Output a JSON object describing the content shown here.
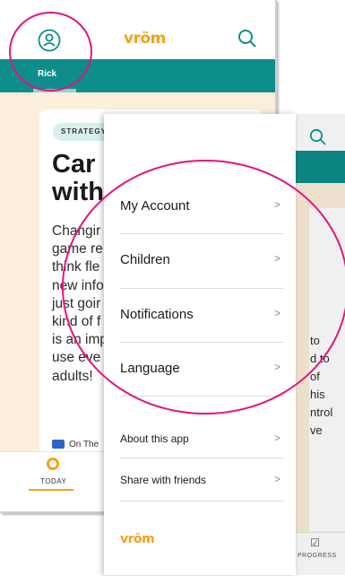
{
  "back_screen": {
    "logo": "vröm",
    "tab_label": "Rick",
    "strategy_badge": "STRATEGY",
    "title_line1": "Car",
    "title_line2": "with",
    "body_lines": [
      "Changir",
      "game re",
      "think fle",
      "new info",
      "just goir",
      "kind of f",
      "is an imp",
      "use eve",
      "adults!"
    ],
    "footer_strip": "On The",
    "nav_today": "TODAY"
  },
  "right_screen": {
    "body_fragments": [
      "to",
      "d to",
      "of",
      "his",
      "ntrol",
      "ve"
    ],
    "nav_progress": "PROGRESS"
  },
  "drawer": {
    "items": [
      {
        "label": "My Account",
        "chevron": ">"
      },
      {
        "label": "Children",
        "chevron": ">"
      },
      {
        "label": "Notifications",
        "chevron": ">"
      },
      {
        "label": "Language",
        "chevron": ">"
      },
      {
        "label": "About this app",
        "chevron": ">"
      },
      {
        "label": "Share with friends",
        "chevron": ">"
      }
    ],
    "logo": "vröm"
  },
  "colors": {
    "teal": "#0d8d8b",
    "brand_orange": "#f5a21b",
    "annotation_magenta": "#e6137d",
    "cream": "#fbeeda"
  },
  "icons": {
    "avatar": "user-avatar-icon",
    "search": "search-icon",
    "chevron": "chevron-right-icon",
    "today": "today-icon",
    "progress": "progress-check-icon"
  }
}
